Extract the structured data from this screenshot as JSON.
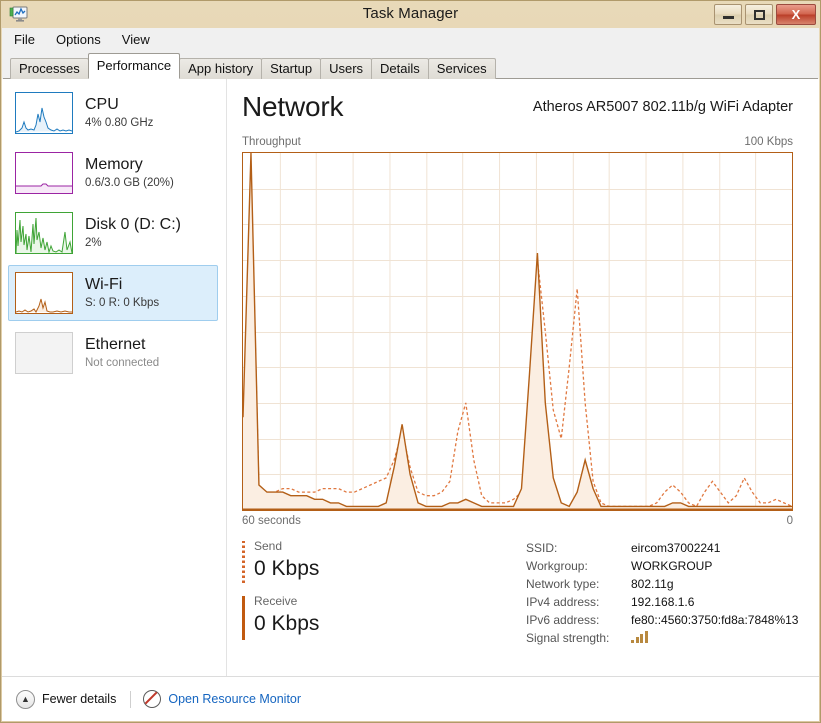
{
  "window": {
    "title": "Task Manager",
    "app_icon": "monitor-chart-icon",
    "buttons": {
      "minimize": "minimize-icon",
      "maximize": "maximize-icon",
      "close": "X"
    }
  },
  "menu": {
    "items": [
      "File",
      "Options",
      "View"
    ]
  },
  "tabs": {
    "items": [
      "Processes",
      "Performance",
      "App history",
      "Startup",
      "Users",
      "Details",
      "Services"
    ],
    "active": "Performance"
  },
  "sidebar": {
    "items": [
      {
        "title": "CPU",
        "sub": "4%  0.80 GHz",
        "color": "#1f7bbf",
        "selected": false,
        "connected": true
      },
      {
        "title": "Memory",
        "sub": "0.6/3.0 GB (20%)",
        "color": "#9b24a3",
        "selected": false,
        "connected": true
      },
      {
        "title": "Disk 0 (D: C:)",
        "sub": "2%",
        "color": "#3fa436",
        "selected": false,
        "connected": true
      },
      {
        "title": "Wi-Fi",
        "sub": "S: 0 R: 0 Kbps",
        "color": "#b35f17",
        "selected": true,
        "connected": true
      },
      {
        "title": "Ethernet",
        "sub": "Not connected",
        "color": "#b35f17",
        "selected": false,
        "connected": false
      }
    ]
  },
  "main": {
    "page_title": "Network",
    "adapter": "Atheros AR5007 802.11b/g WiFi Adapter",
    "graph_label_left": "Throughput",
    "graph_label_right": "100 Kbps",
    "graph_foot_left": "60 seconds",
    "graph_foot_right": "0",
    "legend": [
      {
        "name": "Send",
        "value": "0 Kbps",
        "style": "dotted"
      },
      {
        "name": "Receive",
        "value": "0 Kbps",
        "style": "solid"
      }
    ],
    "info": [
      {
        "key": "SSID:",
        "value": "eircom37002241"
      },
      {
        "key": "Workgroup:",
        "value": "WORKGROUP"
      },
      {
        "key": "Network type:",
        "value": "802.11g"
      },
      {
        "key": "IPv4 address:",
        "value": "192.168.1.6"
      },
      {
        "key": "IPv6 address:",
        "value": "fe80::4560:3750:fd8a:7848%13"
      },
      {
        "key": "Signal strength:",
        "value": "signal-bars-icon"
      }
    ]
  },
  "footer": {
    "fewer_details": "Fewer details",
    "open_resource_monitor": "Open Resource Monitor"
  },
  "chart_data": {
    "type": "area",
    "title": "Throughput",
    "xlabel": "60 seconds",
    "ylabel": "Kbps",
    "ylim": [
      0,
      100
    ],
    "xlim": [
      60,
      0
    ],
    "grid": true,
    "accent_color": "#b35f17",
    "series": [
      {
        "name": "Receive",
        "style": "solid",
        "color": "#b35f17",
        "fill": "#fbeee2",
        "values": [
          26,
          100,
          7,
          5,
          5,
          5,
          4,
          4,
          4,
          3,
          3,
          2,
          2,
          1,
          1,
          1,
          1,
          1,
          2,
          12,
          24,
          10,
          2,
          1,
          1,
          1,
          2,
          2,
          3,
          2,
          1,
          1,
          1,
          1,
          1,
          6,
          38,
          72,
          30,
          9,
          2,
          1,
          5,
          14,
          6,
          1,
          1,
          1,
          1,
          1,
          1,
          1,
          1,
          1,
          2,
          2,
          1,
          1,
          1,
          1,
          1,
          1,
          1,
          1,
          1,
          1,
          1,
          1,
          1,
          1
        ]
      },
      {
        "name": "Send",
        "style": "dashed",
        "color": "#e07840",
        "values": [
          18,
          96,
          6,
          4,
          5,
          6,
          6,
          5,
          5,
          5,
          6,
          6,
          6,
          5,
          5,
          6,
          7,
          8,
          9,
          14,
          22,
          12,
          5,
          4,
          4,
          5,
          8,
          22,
          30,
          14,
          4,
          2,
          2,
          2,
          3,
          5,
          36,
          70,
          50,
          28,
          20,
          40,
          62,
          30,
          8,
          2,
          1,
          1,
          1,
          1,
          1,
          1,
          2,
          5,
          7,
          5,
          2,
          1,
          5,
          8,
          5,
          2,
          4,
          9,
          5,
          2,
          2,
          3,
          2,
          1
        ]
      }
    ]
  }
}
